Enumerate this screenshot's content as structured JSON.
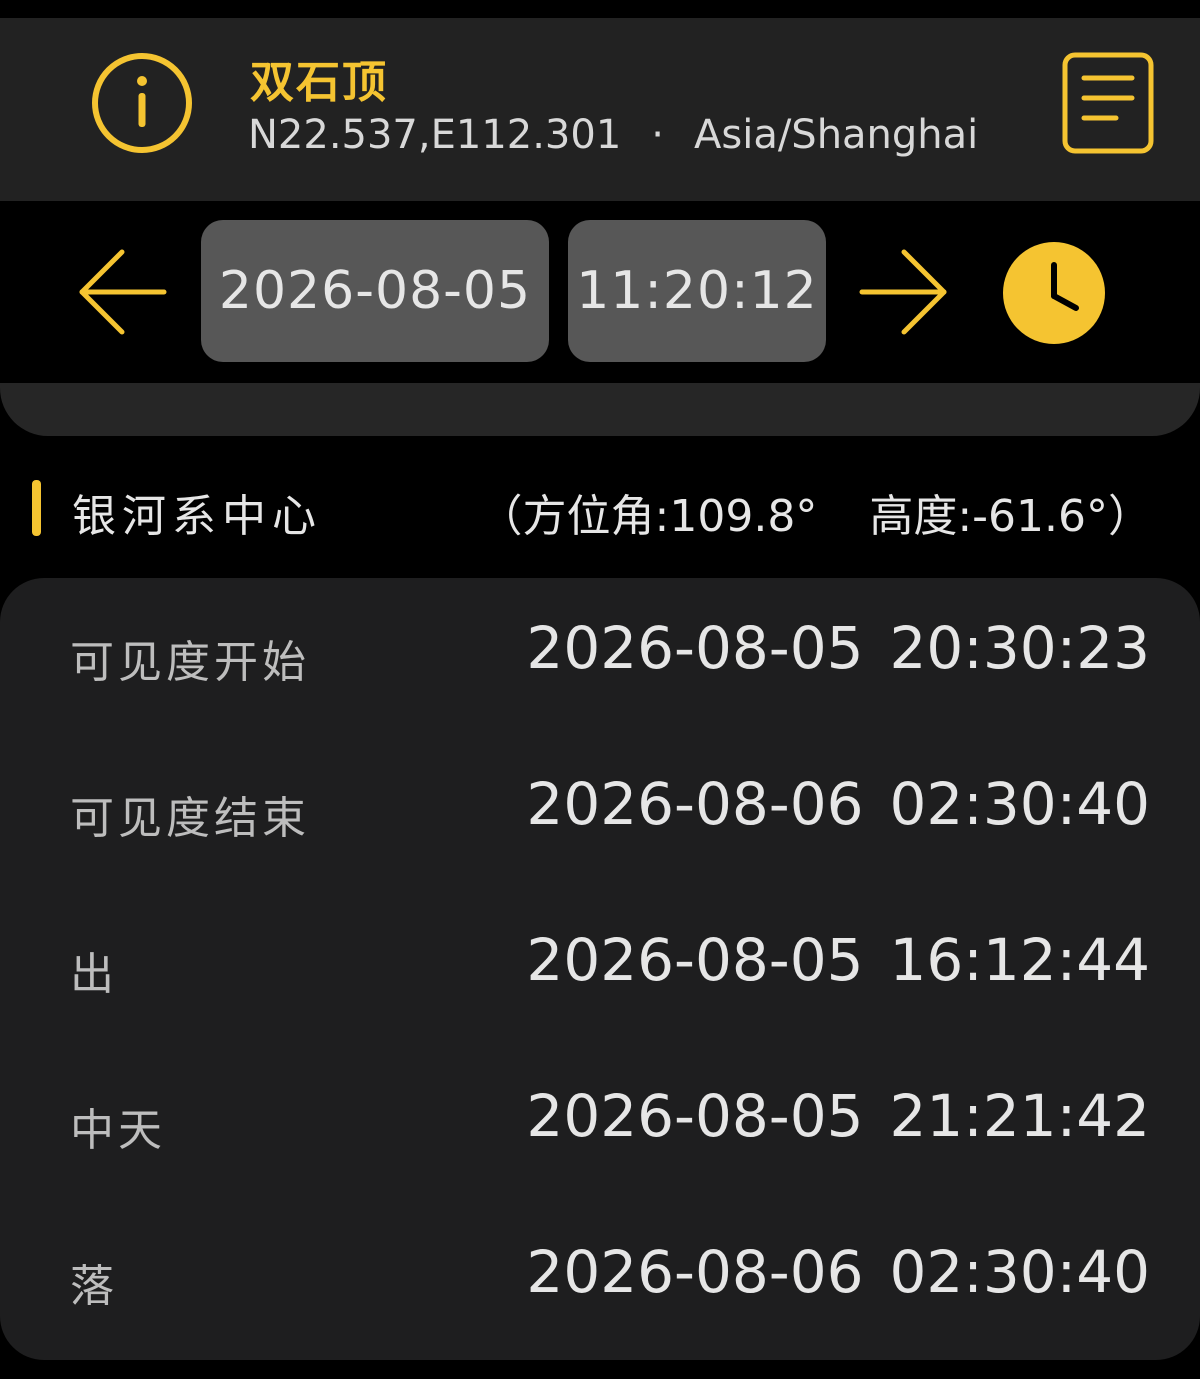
{
  "header": {
    "location_name": "双石顶",
    "coordinates": "N22.537,E112.301",
    "separator": "·",
    "timezone": "Asia/Shanghai",
    "info_icon": "info-circle-icon",
    "menu_icon": "list-document-icon",
    "accent_color": "#F5C431"
  },
  "navbar": {
    "date": "2026-08-05",
    "time": "11:20:12",
    "prev_icon": "arrow-left-icon",
    "next_icon": "arrow-right-icon",
    "clock_icon": "clock-icon"
  },
  "section": {
    "title": "银河系中心",
    "open_paren": "（",
    "azimuth": "方位角:109.8°",
    "altitude": "高度:-61.6°",
    "close_paren": "）"
  },
  "rows": [
    {
      "label": "可见度开始",
      "date": "2026-08-05",
      "time": "20:30:23"
    },
    {
      "label": "可见度结束",
      "date": "2026-08-06",
      "time": "02:30:40"
    },
    {
      "label": "出",
      "date": "2026-08-05",
      "time": "16:12:44"
    },
    {
      "label": "中天",
      "date": "2026-08-05",
      "time": "21:21:42"
    },
    {
      "label": "落",
      "date": "2026-08-06",
      "time": "02:30:40"
    }
  ]
}
